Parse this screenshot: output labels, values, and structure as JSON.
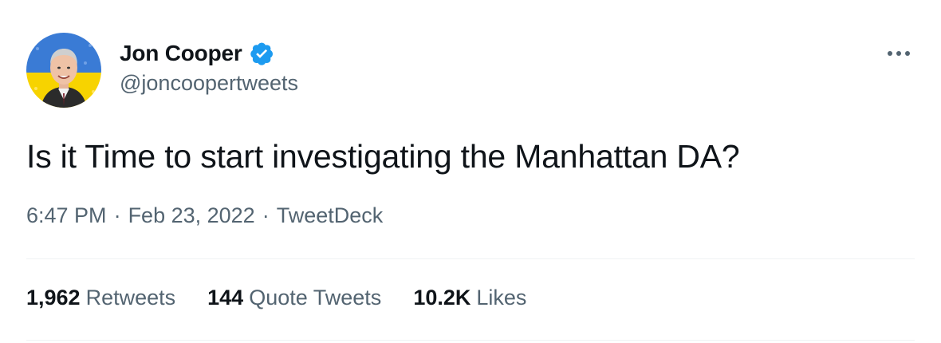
{
  "author": {
    "display_name": "Jon Cooper",
    "handle": "@joncoopertweets",
    "verified": true,
    "verified_color": "#1d9bf0",
    "avatar_icon": "avatar-photo"
  },
  "tweet": {
    "text": "Is it Time to start investigating the Manhattan DA?",
    "time": "6:47 PM",
    "date": "Feb 23, 2022",
    "source": "TweetDeck",
    "separator": "·"
  },
  "stats": {
    "retweets_count": "1,962",
    "retweets_label": "Retweets",
    "quotes_count": "144",
    "quotes_label": "Quote Tweets",
    "likes_count": "10.2K",
    "likes_label": "Likes"
  },
  "colors": {
    "text_primary": "#0f1419",
    "text_secondary": "#536471",
    "divider": "#eff3f4",
    "avatar_top": "#3a7bd5",
    "avatar_bottom": "#f7d300"
  }
}
